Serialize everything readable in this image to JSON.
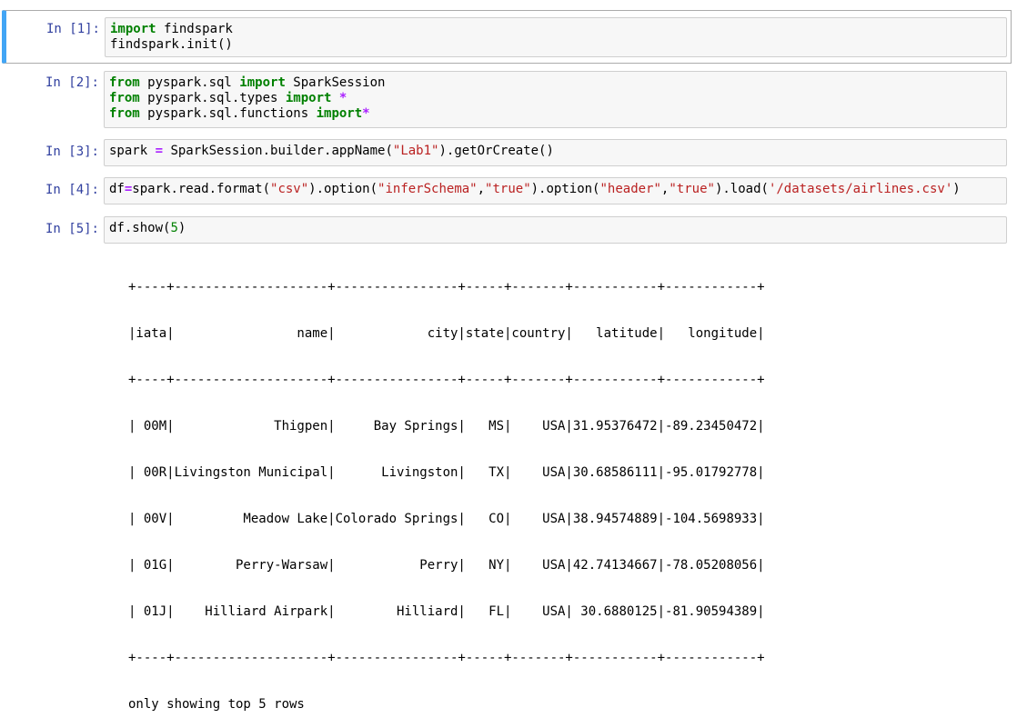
{
  "cells": [
    {
      "prompt": "In [1]:",
      "lines": [
        [
          {
            "t": "import",
            "c": "kw"
          },
          {
            "t": " findspark",
            "c": ""
          }
        ],
        [
          {
            "t": "findspark.init()",
            "c": ""
          }
        ]
      ]
    },
    {
      "prompt": "In [2]:",
      "lines": [
        [
          {
            "t": "from",
            "c": "kw"
          },
          {
            "t": " pyspark.sql ",
            "c": ""
          },
          {
            "t": "import",
            "c": "kw"
          },
          {
            "t": " SparkSession",
            "c": ""
          }
        ],
        [
          {
            "t": "from",
            "c": "kw"
          },
          {
            "t": " pyspark.sql.types ",
            "c": ""
          },
          {
            "t": "import",
            "c": "kw"
          },
          {
            "t": " ",
            "c": ""
          },
          {
            "t": "*",
            "c": "op"
          }
        ],
        [
          {
            "t": "from",
            "c": "kw"
          },
          {
            "t": " pyspark.sql.functions ",
            "c": ""
          },
          {
            "t": "import",
            "c": "kw"
          },
          {
            "t": "*",
            "c": "op"
          }
        ]
      ]
    },
    {
      "prompt": "In [3]:",
      "lines": [
        [
          {
            "t": "spark ",
            "c": ""
          },
          {
            "t": "=",
            "c": "op"
          },
          {
            "t": " SparkSession.builder.appName(",
            "c": ""
          },
          {
            "t": "\"Lab1\"",
            "c": "str"
          },
          {
            "t": ").getOrCreate()",
            "c": ""
          }
        ]
      ]
    },
    {
      "prompt": "In [4]:",
      "lines": [
        [
          {
            "t": "df",
            "c": ""
          },
          {
            "t": "=",
            "c": "op"
          },
          {
            "t": "spark.read.format(",
            "c": ""
          },
          {
            "t": "\"csv\"",
            "c": "str"
          },
          {
            "t": ").option(",
            "c": ""
          },
          {
            "t": "\"inferSchema\"",
            "c": "str"
          },
          {
            "t": ",",
            "c": ""
          },
          {
            "t": "\"true\"",
            "c": "str"
          },
          {
            "t": ").option(",
            "c": ""
          },
          {
            "t": "\"header\"",
            "c": "str"
          },
          {
            "t": ",",
            "c": ""
          },
          {
            "t": "\"true\"",
            "c": "str"
          },
          {
            "t": ").load(",
            "c": ""
          },
          {
            "t": "'/datasets/airlines.csv'",
            "c": "str"
          },
          {
            "t": ")",
            "c": ""
          }
        ]
      ]
    },
    {
      "prompt": "In [5]:",
      "lines": [
        [
          {
            "t": "df.show(",
            "c": ""
          },
          {
            "t": "5",
            "c": "num"
          },
          {
            "t": ")",
            "c": ""
          }
        ]
      ]
    }
  ],
  "output": {
    "lines": [
      "+----+--------------------+----------------+-----+-------+-----------+------------+",
      "|iata|                name|            city|state|country|   latitude|   longitude|",
      "+----+--------------------+----------------+-----+-------+-----------+------------+",
      "| 00M|             Thigpen|     Bay Springs|   MS|    USA|31.95376472|-89.23450472|",
      "| 00R|Livingston Municipal|      Livingston|   TX|    USA|30.68586111|-95.01792778|",
      "| 00V|         Meadow Lake|Colorado Springs|   CO|    USA|38.94574889|-104.5698933|",
      "| 01G|        Perry-Warsaw|           Perry|   NY|    USA|42.74134667|-78.05208056|",
      "| 01J|    Hilliard Airpark|        Hilliard|   FL|    USA| 30.6880125|-81.90594389|",
      "+----+--------------------+----------------+-----+-------+-----------+------------+",
      "only showing top 5 rows"
    ]
  }
}
